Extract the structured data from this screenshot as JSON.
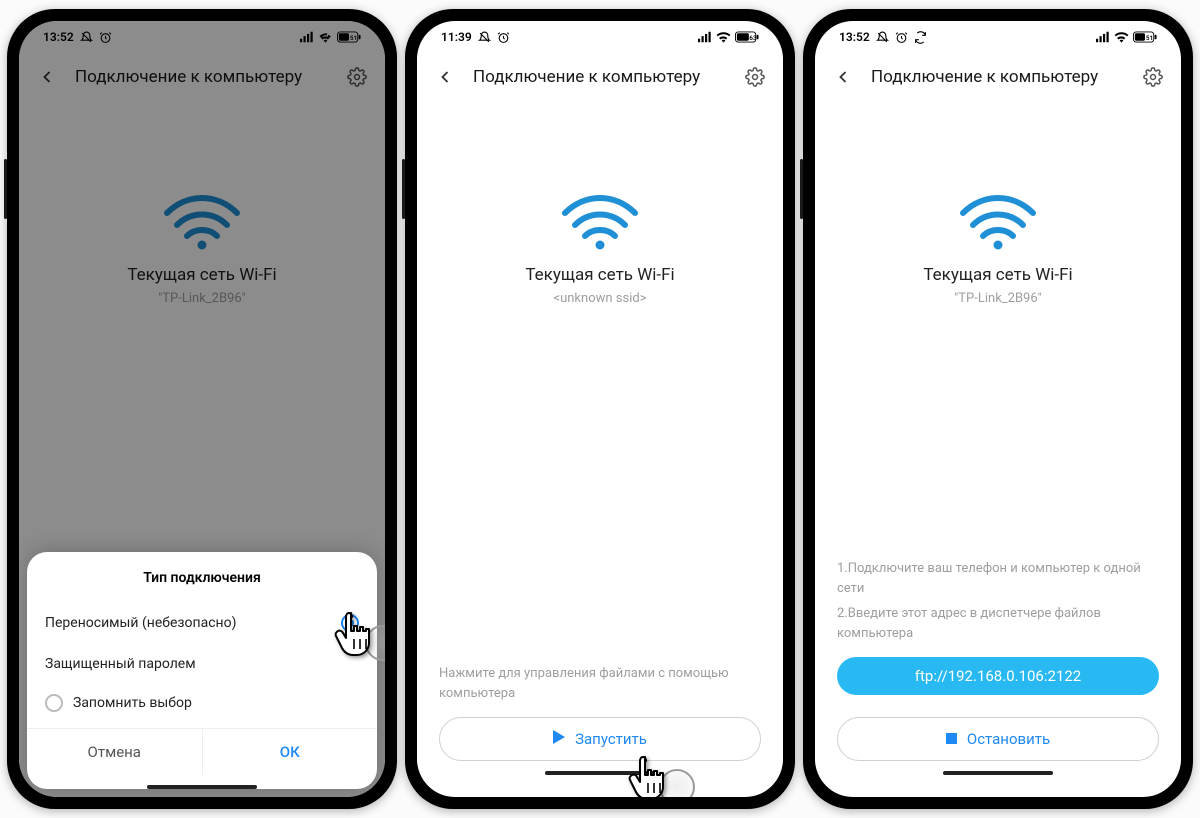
{
  "phones": [
    {
      "status": {
        "time": "13:52",
        "battery": "51"
      },
      "header": {
        "title": "Подключение к компьютеру"
      },
      "wifi": {
        "label": "Текущая сеть Wi-Fi",
        "ssid": "\"TP-Link_2B96\""
      },
      "sheet": {
        "title": "Тип подключения",
        "option1": "Переносимый (небезопасно)",
        "option2": "Защищенный паролем",
        "remember": "Запомнить выбор",
        "cancel": "Отмена",
        "ok": "ОК"
      }
    },
    {
      "status": {
        "time": "11:39",
        "battery": "63"
      },
      "header": {
        "title": "Подключение к компьютеру"
      },
      "wifi": {
        "label": "Текущая сеть Wi-Fi",
        "ssid": "<unknown ssid>"
      },
      "hint": "Нажмите для управления файлами с помощью компьютера",
      "action": "Запустить"
    },
    {
      "status": {
        "time": "13:52",
        "battery": "51"
      },
      "header": {
        "title": "Подключение к компьютеру"
      },
      "wifi": {
        "label": "Текущая сеть Wi-Fi",
        "ssid": "\"TP-Link_2B96\""
      },
      "steps": {
        "s1": "1.Подключите ваш телефон и компьютер к одной сети",
        "s2": "2.Введите этот адрес в диспетчере файлов компьютера"
      },
      "address": "ftp://192.168.0.106:2122",
      "action": "Остановить"
    }
  ],
  "icons": {
    "back": "back-icon",
    "gear": "gear-icon",
    "wifi": "wifi-icon",
    "play": "play-icon",
    "stop": "stop-icon",
    "bell": "bell-off-icon",
    "alarm": "alarm-icon",
    "sync": "sync-icon",
    "signal": "signal-icon",
    "wifiSmall": "wifi-small-icon",
    "batt": "battery-icon"
  }
}
